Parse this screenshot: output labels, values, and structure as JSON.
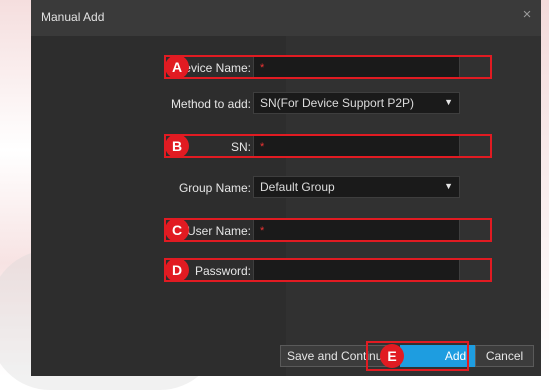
{
  "dialog": {
    "title": "Manual Add",
    "close_glyph": "×"
  },
  "fields": {
    "device_name": {
      "label": "Device Name:",
      "required_mark": "*",
      "value": ""
    },
    "method": {
      "label": "Method to add:",
      "value": "SN(For Device Support P2P)"
    },
    "sn": {
      "label": "SN:",
      "required_mark": "*",
      "value": ""
    },
    "group": {
      "label": "Group Name:",
      "value": "Default Group"
    },
    "user_name": {
      "label": "User Name:",
      "required_mark": "*",
      "value": ""
    },
    "password": {
      "label": "Password:",
      "value": ""
    }
  },
  "badges": [
    "A",
    "B",
    "C",
    "D",
    "E"
  ],
  "buttons": {
    "save_continue": "Save and Continu",
    "add": "Add",
    "cancel": "Cancel"
  },
  "colors": {
    "highlight": "#e11b22",
    "primary": "#1e9de0",
    "dialog_bg": "#2d2d2d"
  },
  "icons": {
    "close": "close-icon",
    "dropdown": "chevron-down-icon"
  }
}
